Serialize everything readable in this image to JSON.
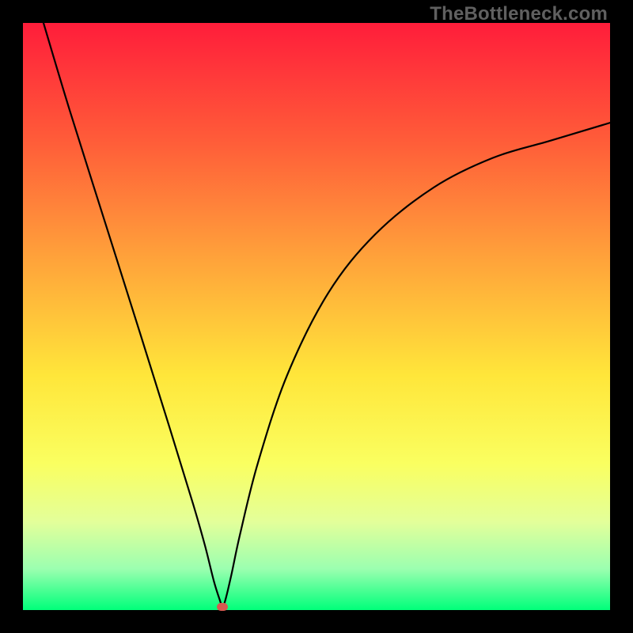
{
  "watermark": "TheBottleneck.com",
  "chart_data": {
    "type": "line",
    "title": "",
    "xlabel": "",
    "ylabel": "",
    "xlim": [
      0,
      1
    ],
    "ylim": [
      0,
      1
    ],
    "series": [
      {
        "name": "bottleneck-curve",
        "x": [
          0.035,
          0.08,
          0.14,
          0.2,
          0.25,
          0.29,
          0.31,
          0.325,
          0.335,
          0.34,
          0.345,
          0.355,
          0.37,
          0.4,
          0.45,
          0.52,
          0.6,
          0.7,
          0.8,
          0.9,
          1.0
        ],
        "y": [
          1.0,
          0.85,
          0.66,
          0.47,
          0.31,
          0.18,
          0.11,
          0.05,
          0.018,
          0.006,
          0.018,
          0.06,
          0.13,
          0.25,
          0.4,
          0.54,
          0.64,
          0.72,
          0.77,
          0.8,
          0.83
        ]
      }
    ],
    "marker": {
      "x": 0.34,
      "y": 0.006,
      "color": "#d65a50"
    },
    "background_gradient": [
      "#ff1d3a",
      "#ff5c39",
      "#ffa23a",
      "#ffe63a",
      "#faff60",
      "#e3ff9a",
      "#9bffb0",
      "#00ff7a"
    ]
  }
}
